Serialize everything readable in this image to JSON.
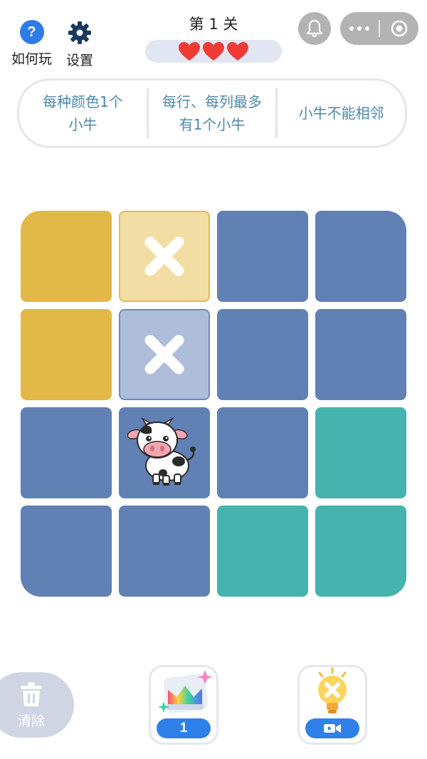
{
  "header": {
    "help_label": "如何玩",
    "help_icon_text": "?",
    "settings_label": "设置",
    "level_title": "第 1 关",
    "hearts": 3,
    "heart_color": "#ef3b36"
  },
  "system": {
    "bell_icon": "bell-icon",
    "menu_icon": "more-dots-icon",
    "close_icon": "target-circle-icon"
  },
  "rules": [
    {
      "line1": "每种颜色1个",
      "line2": "小牛"
    },
    {
      "line1": "每行、每列最多",
      "line2": "有1个小牛"
    },
    {
      "line1": "小牛不能相邻",
      "line2": ""
    }
  ],
  "board": {
    "size": 4,
    "colors": {
      "yellow": "#e2b847",
      "blue": "#6180b4",
      "teal": "#45b3ae"
    },
    "cells": [
      [
        "yellow",
        "yellow-marked",
        "blue",
        "blue"
      ],
      [
        "yellow",
        "blue-marked",
        "blue",
        "blue"
      ],
      [
        "blue",
        "blue-cow",
        "blue",
        "teal"
      ],
      [
        "blue",
        "blue",
        "teal",
        "teal"
      ]
    ]
  },
  "tools": {
    "clear_label": "清除",
    "rainbow_count": "1",
    "hint_icon": "video-icon"
  }
}
